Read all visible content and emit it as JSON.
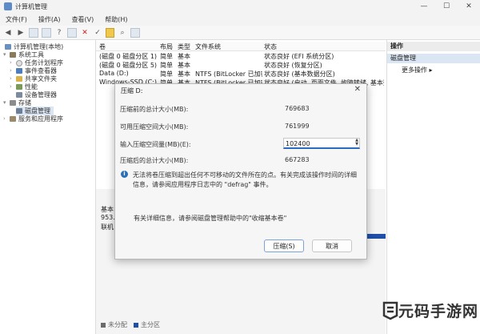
{
  "window": {
    "title": "计算机管理",
    "buttons": [
      "—",
      "☐",
      "✕"
    ]
  },
  "menu": [
    "文件(F)",
    "操作(A)",
    "查看(V)",
    "帮助(H)"
  ],
  "toolbar_icons": [
    "back-icon",
    "forward-icon",
    "tree-icon",
    "properties-icon",
    "help-icon",
    "list-icon",
    "delete-icon",
    "check-icon",
    "open-icon",
    "search-icon",
    "refresh-icon"
  ],
  "tree": {
    "root": "计算机管理(本地)",
    "items": [
      {
        "label": "系统工具",
        "level": 1
      },
      {
        "label": "任务计划程序",
        "level": 2
      },
      {
        "label": "事件查看器",
        "level": 2
      },
      {
        "label": "共享文件夹",
        "level": 2
      },
      {
        "label": "性能",
        "level": 2
      },
      {
        "label": "设备管理器",
        "level": 2
      },
      {
        "label": "存储",
        "level": 1
      },
      {
        "label": "磁盘管理",
        "level": 2
      },
      {
        "label": "服务和应用程序",
        "level": 1
      }
    ]
  },
  "volumes": {
    "headers": [
      "卷",
      "布局",
      "类型",
      "文件系统",
      "状态"
    ],
    "rows": [
      [
        "(磁盘 0 磁盘分区 1)",
        "简单",
        "基本",
        "",
        "状态良好 (EFI 系统分区)"
      ],
      [
        "(磁盘 0 磁盘分区 5)",
        "简单",
        "基本",
        "",
        "状态良好 (恢复分区)"
      ],
      [
        "Data (D:)",
        "简单",
        "基本",
        "NTFS (BitLocker 已加密)",
        "状态良好 (基本数据分区)"
      ],
      [
        "Windows-SSD (C:)",
        "简单",
        "基本",
        "NTFS (BitLocker 已加密)",
        "状态良好 (启动, 页面文件, 故障转储, 基本数据分区)"
      ]
    ]
  },
  "disk": {
    "lines": [
      "基本",
      "953.",
      "联机"
    ],
    "legend": [
      "未分配",
      "主分区"
    ]
  },
  "actions": {
    "header": "操作",
    "section": "磁盘管理",
    "more": "更多操作"
  },
  "dialog": {
    "title": "压缩 D:",
    "fields": [
      {
        "label": "压缩前的总计大小(MB):",
        "value": "769683"
      },
      {
        "label": "可用压缩空间大小(MB):",
        "value": "761999"
      },
      {
        "label": "输入压缩空间量(MB)(E):",
        "value": "102400"
      },
      {
        "label": "压缩后的总计大小(MB):",
        "value": "667283"
      }
    ],
    "info": "无法将卷压缩到超出任何不可移动的文件所在的点。有关完成该操作时间的详细信息，请参阅应用程序日志中的 \"defrag\" 事件。",
    "help": "有关详细信息，请参阅磁盘管理帮助中的\"收缩基本卷\"",
    "shrink_label": "压缩(S)",
    "cancel_label": "取消"
  },
  "watermark": "元码手游网"
}
